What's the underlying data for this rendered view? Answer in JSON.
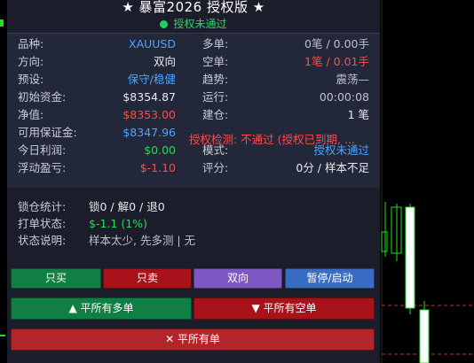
{
  "panel": {
    "title": "★ 暴富2026 授权版 ★",
    "auth_status": "授权未通过"
  },
  "left_rows": [
    {
      "label": "品种:",
      "value": "XAUUSD",
      "color": "blue"
    },
    {
      "label": "方向:",
      "value": "双向",
      "color": "white"
    },
    {
      "label": "预设:",
      "value": "保守/稳健",
      "color": "blue"
    },
    {
      "label": "初始资金:",
      "value": "$8354.87",
      "color": "white"
    },
    {
      "label": "净值:",
      "value": "$8353.00",
      "color": "red"
    },
    {
      "label": "可用保证金:",
      "value": "$8347.96",
      "color": "blue"
    },
    {
      "label": "今日利润:",
      "value": "$0.00",
      "color": "green"
    },
    {
      "label": "浮动盈亏:",
      "value": "$-1.10",
      "color": "red"
    }
  ],
  "right_rows": [
    {
      "label": "多单:",
      "value": "0笔 / 0.00手",
      "color": "gray"
    },
    {
      "label": "空单:",
      "value": "1笔 / 0.01手",
      "color": "red"
    },
    {
      "label": "趋势:",
      "value": "震荡—",
      "color": "gray"
    },
    {
      "label": "运行:",
      "value": "00:00:08",
      "color": "gray"
    },
    {
      "label": "建仓:",
      "value": "1 笔",
      "color": "white"
    },
    {
      "label": "",
      "value": "",
      "color": "white"
    },
    {
      "label": "模式:",
      "value": "授权未通过",
      "color": "blue"
    },
    {
      "label": "评分:",
      "value": "0分 / 样本不足",
      "color": "white"
    }
  ],
  "auth_detail": "授权检测: 不通过 (授权已到期, ...",
  "lower": {
    "lock_label": "锁仓统计:",
    "lock_value": "锁0 / 解0 / 退0",
    "order_label": "打单状态:",
    "order_value": "$-1.1 (1%)",
    "state_label": "状态说明:",
    "state_value": "样本太少, 先多测 | 无"
  },
  "buttons": {
    "buy": "只买",
    "sell": "只卖",
    "both": "双向",
    "pause": "暂停/启动",
    "close_long": "▲ 平所有多单",
    "close_short": "▼ 平所有空单",
    "close_all": "✕ 平所有单"
  },
  "colors": {
    "panel_bg": "#1b1d2a",
    "info_bg": "#23273a",
    "green_btn": "#0f7f44",
    "red_btn": "#a8121a",
    "purple_btn": "#7e58c2",
    "blue_btn": "#3a6cc4",
    "close_all_btn": "#b0262a",
    "bull_candle": "#22dd22"
  }
}
